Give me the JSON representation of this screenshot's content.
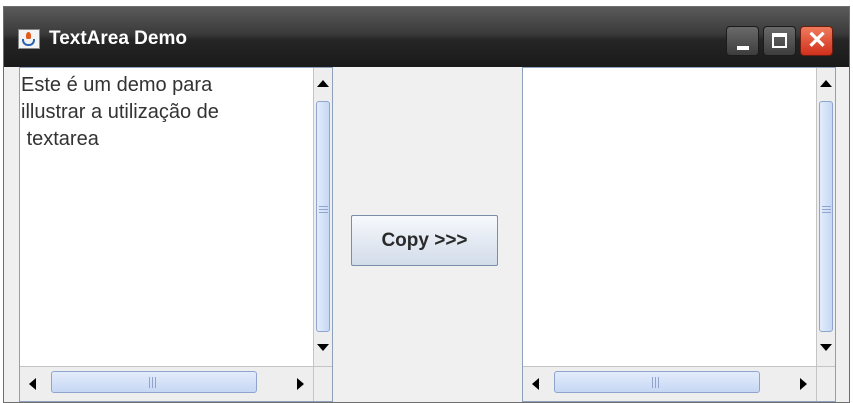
{
  "window": {
    "title": "TextArea Demo",
    "buttons": {
      "minimize": "minimize",
      "maximize": "maximize",
      "close": "✕"
    }
  },
  "left_textarea": {
    "value": "Este é um demo para\nillustrar a utilização de\n textarea"
  },
  "right_textarea": {
    "value": ""
  },
  "copy_button": {
    "label": "Copy >>>"
  },
  "colors": {
    "titlebar": "#252525",
    "close_button": "#e0401f",
    "scrollbar_thumb": "#c6d8f4",
    "panel_background": "#f0f0f0"
  }
}
